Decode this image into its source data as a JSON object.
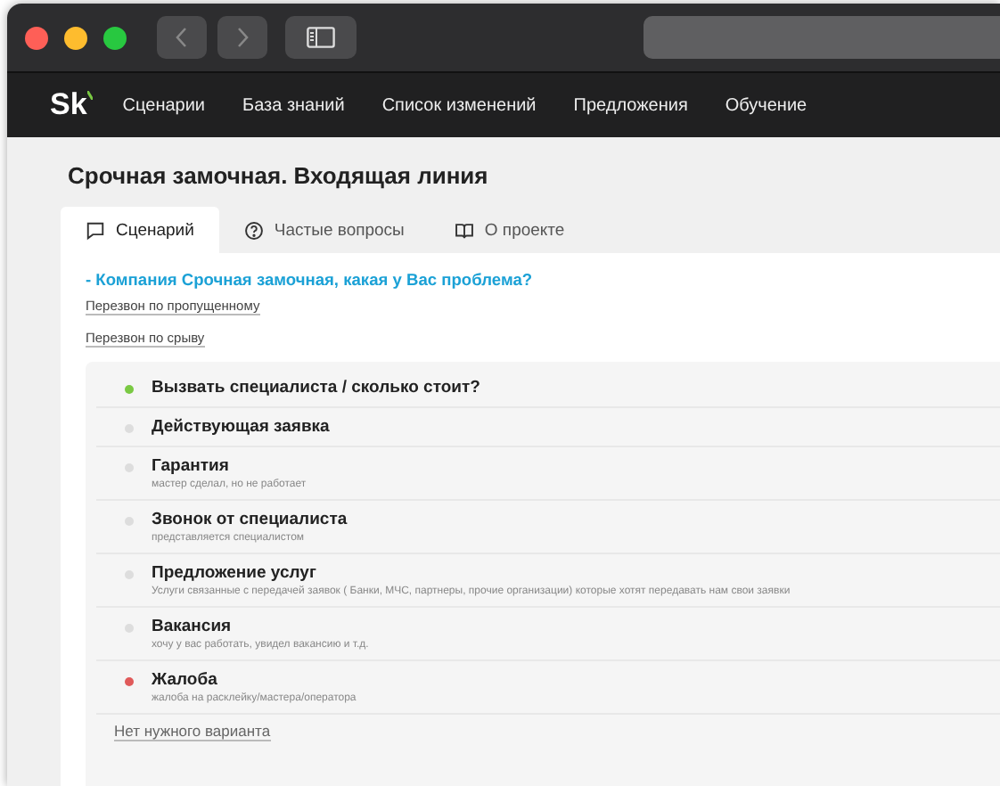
{
  "nav": {
    "logo": "Sk",
    "items": [
      "Сценарии",
      "База знаний",
      "Список изменений",
      "Предложения",
      "Обучение"
    ]
  },
  "page_title": "Срочная замочная. Входящая линия",
  "tabs": [
    {
      "label": "Сценарий",
      "kind": "chat",
      "selected": true
    },
    {
      "label": "Частые вопросы",
      "kind": "question",
      "selected": false
    },
    {
      "label": "О проекте",
      "kind": "book",
      "selected": false
    }
  ],
  "greeting": "- Компания Срочная замочная, какая у Вас проблема?",
  "links": [
    "Перезвон по пропущенному",
    "Перезвон по срыву"
  ],
  "options": [
    {
      "title": "Вызвать специалиста / сколько стоит?",
      "color": "#7ac943"
    },
    {
      "title": "Действующая заявка",
      "color": "#dddddd"
    },
    {
      "title": "Гарантия",
      "subtitle": "мастер сделал, но не работает",
      "color": "#dddddd"
    },
    {
      "title": "Звонок от специалиста",
      "subtitle": "представляется специалистом",
      "color": "#dddddd"
    },
    {
      "title": "Предложение услуг",
      "subtitle": "Услуги связанные с передачей заявок ( Банки, МЧС, партнеры, прочие организации) которые хотят передавать нам свои заявки",
      "color": "#dddddd"
    },
    {
      "title": "Вакансия",
      "subtitle": "хочу у вас работать, увидел вакансию и т.д.",
      "color": "#dddddd"
    },
    {
      "title": "Жалоба",
      "subtitle": "жалоба на расклейку/мастера/оператора",
      "color": "#e05a5a"
    }
  ],
  "no_option": "Нет нужного варианта"
}
